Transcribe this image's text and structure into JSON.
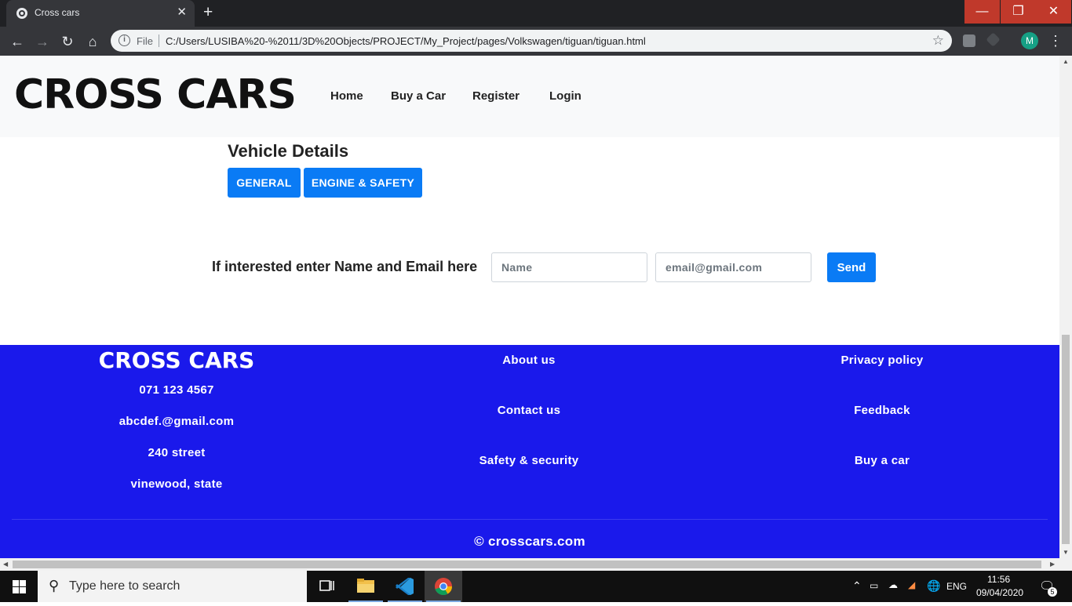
{
  "browser": {
    "tab_title": "Cross cars",
    "tab_close": "✕",
    "new_tab": "+",
    "window_controls": {
      "minimize": "—",
      "maximize": "❐",
      "close": "✕"
    },
    "address": {
      "scheme": "File",
      "url": "C:/Users/LUSIBA%20-%2011/3D%20Objects/PROJECT/My_Project/pages/Volkswagen/tiguan/tiguan.html"
    },
    "profile_initial": "M"
  },
  "site": {
    "brand": "CROSS CARS",
    "nav": [
      "Home",
      "Buy a Car",
      "Register",
      "Login"
    ]
  },
  "vehicle": {
    "title": "Vehicle Details",
    "tabs": [
      "GENERAL",
      "ENGINE & SAFETY"
    ]
  },
  "interest_form": {
    "label": "If interested enter Name and Email here",
    "name_placeholder": "Name",
    "email_placeholder": "email@gmail.com",
    "send_label": "Send"
  },
  "footer": {
    "brand": "CROSS CARS",
    "contact": [
      "071 123 4567",
      "abcdef.@gmail.com",
      "240 street",
      "vinewood, state"
    ],
    "middle_links": [
      "About us",
      "Contact us",
      "Safety & security"
    ],
    "right_links": [
      "Privacy policy",
      "Feedback",
      "Buy a car"
    ],
    "copyright": "© crosscars.com"
  },
  "taskbar": {
    "search_placeholder": "Type here to search",
    "language": "ENG",
    "time": "11:56",
    "date": "09/04/2020",
    "notification_count": "5"
  },
  "colors": {
    "primary_button": "#0a7bf5",
    "footer_bg": "#1a19eb",
    "header_bg": "#f8f9fa"
  }
}
